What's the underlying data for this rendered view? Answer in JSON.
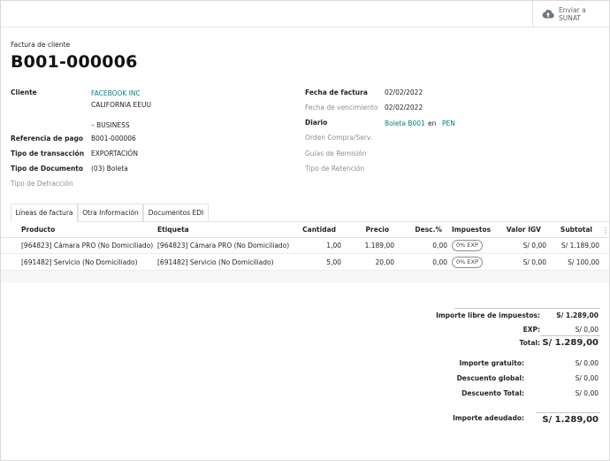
{
  "toolbar": {
    "sunat_line1": "Enviar a",
    "sunat_line2": "SUNAT",
    "sunat_icon": "cloud-upload-icon"
  },
  "header": {
    "doc_type": "Factura de cliente",
    "doc_number": "B001-000006"
  },
  "left_fields": {
    "cliente_label": "Cliente",
    "cliente_name": "FACEBOOK INC",
    "cliente_addr1": "CALIFORNIA EEUU",
    "cliente_addr2": "– BUSINESS",
    "ref_label": "Referencia de pago",
    "ref_value": "B001-000006",
    "tipo_trans_label": "Tipo de transacción",
    "tipo_trans_value": "EXPORTACIÓN",
    "tipo_doc_label": "Tipo de Documento",
    "tipo_doc_value": "(03) Boleta",
    "detraccion_label": "Tipo de Detracción"
  },
  "right_fields": {
    "fecha_label": "Fecha de factura",
    "fecha_value": "02/02/2022",
    "venc_label": "Fecha de vencimiento",
    "venc_value": "02/02/2022",
    "diario_label": "Diario",
    "diario_value": "Boleta B001",
    "diario_en": "en",
    "diario_currency": "PEN",
    "orden_label": "Orden Compra/Serv.",
    "guias_label": "Guías de Remisión",
    "retencion_label": "Tipo de Retención"
  },
  "tabs": [
    "Líneas de factura",
    "Otra Información",
    "Documentos EDI"
  ],
  "table": {
    "headers": [
      "Producto",
      "Etiqueta",
      "Cantidad",
      "Precio",
      "Desc.%",
      "Impuestos",
      "Valor IGV",
      "Subtotal"
    ],
    "rows": [
      {
        "producto": "[964823] Cámara PRO (No Domiciliado)",
        "etiqueta": "[964823] Cámara PRO (No Domiciliado)",
        "cantidad": "1,00",
        "precio": "1.189,00",
        "desc": "0,00",
        "impuesto": "0% EXP",
        "igv": "S/ 0,00",
        "subtotal": "S/ 1.189,00"
      },
      {
        "producto": "[691482] Servicio (No Domiciliado)",
        "etiqueta": "[691482] Servicio (No Domiciliado)",
        "cantidad": "5,00",
        "precio": "20,00",
        "desc": "0,00",
        "impuesto": "0% EXP",
        "igv": "S/ 0,00",
        "subtotal": "S/ 100,00"
      }
    ]
  },
  "totals": {
    "libre_label": "Importe libre de impuestos:",
    "libre_value": "S/ 1.289,00",
    "exp_label": "EXP:",
    "exp_value": "S/ 0,00",
    "total_label": "Total:",
    "total_value": "S/ 1.289,00",
    "gratuito_label": "Importe gratuito:",
    "gratuito_value": "S/ 0,00",
    "desc_global_label": "Descuento global:",
    "desc_global_value": "S/ 0,00",
    "desc_total_label": "Descuento Total:",
    "desc_total_value": "S/ 0,00",
    "adeudado_label": "Importe adeudado:",
    "adeudado_value": "S/ 1.289,00"
  },
  "colors": {
    "link": "#017e84",
    "muted": "#8f8f8f"
  }
}
